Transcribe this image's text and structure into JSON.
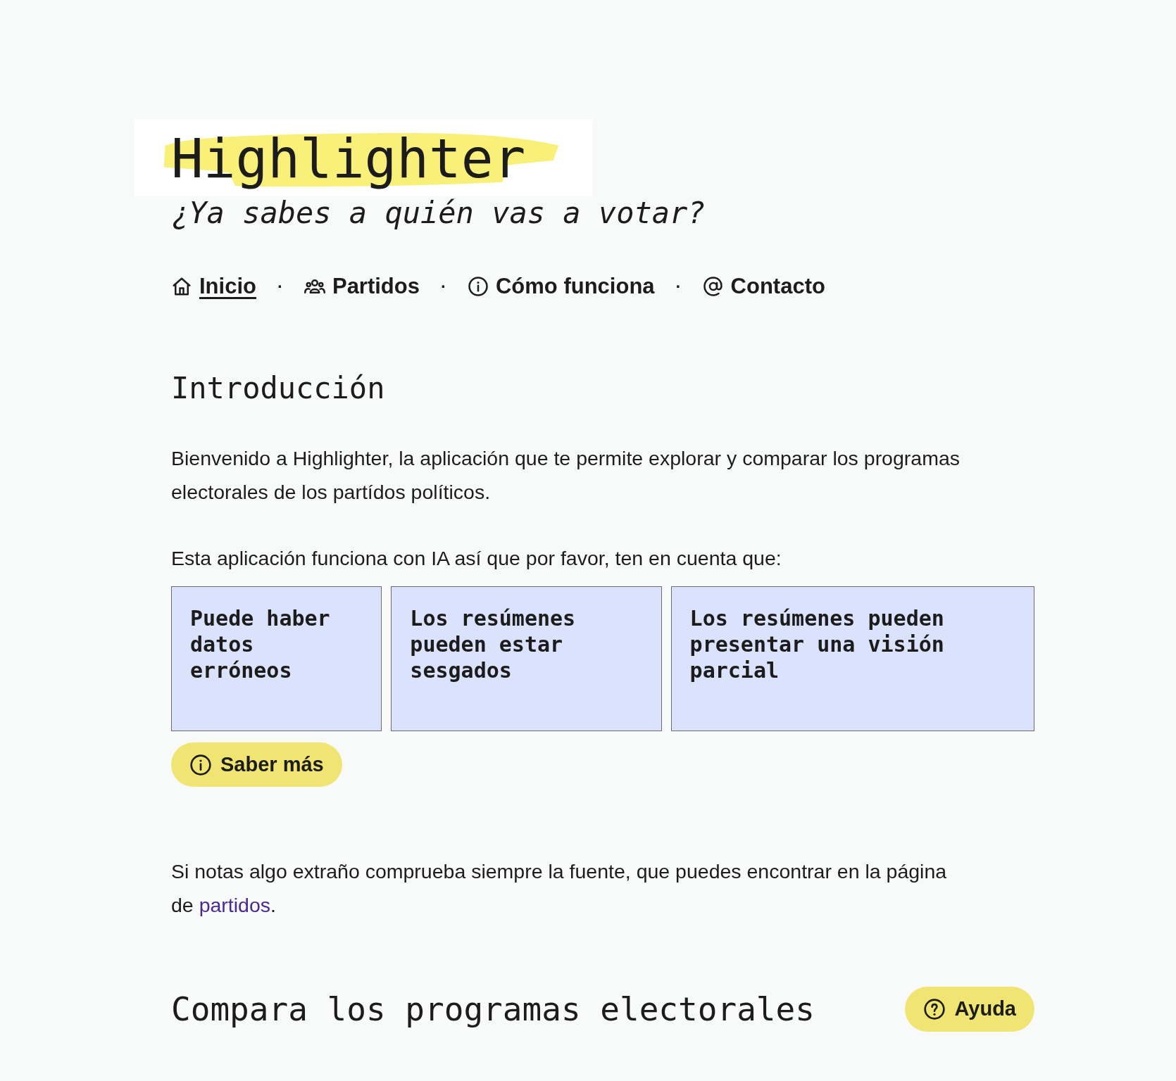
{
  "header": {
    "title": "Highlighter",
    "subtitle": "¿Ya sabes a quién vas a votar?"
  },
  "nav": [
    {
      "label": "Inicio",
      "selected": true
    },
    {
      "label": "Partidos",
      "selected": false
    },
    {
      "label": "Cómo funciona",
      "selected": false
    },
    {
      "label": "Contacto",
      "selected": false
    }
  ],
  "nav_separator": "·",
  "intro": {
    "heading": "Introducción",
    "paragraphs": [
      "Bienvenido a Highlighter, la aplicación que te permite explorar y comparar los programas electorales de los partídos políticos.",
      "Esta aplicación funciona con IA así que por favor, ten en cuenta que:"
    ],
    "warnings": [
      "Puede haber datos erróneos",
      "Los resúmenes pueden estar sesgados",
      "Los resúmenes pueden presentar una visión parcial"
    ],
    "more_button": "Saber más",
    "source_note": {
      "before": "Si notas algo extraño comprueba siempre la fuente, que puedes encontrar en la página de ",
      "link": "partidos",
      "after": "."
    }
  },
  "compare": {
    "heading": "Compara los programas electorales",
    "help_button": "Ayuda"
  }
}
